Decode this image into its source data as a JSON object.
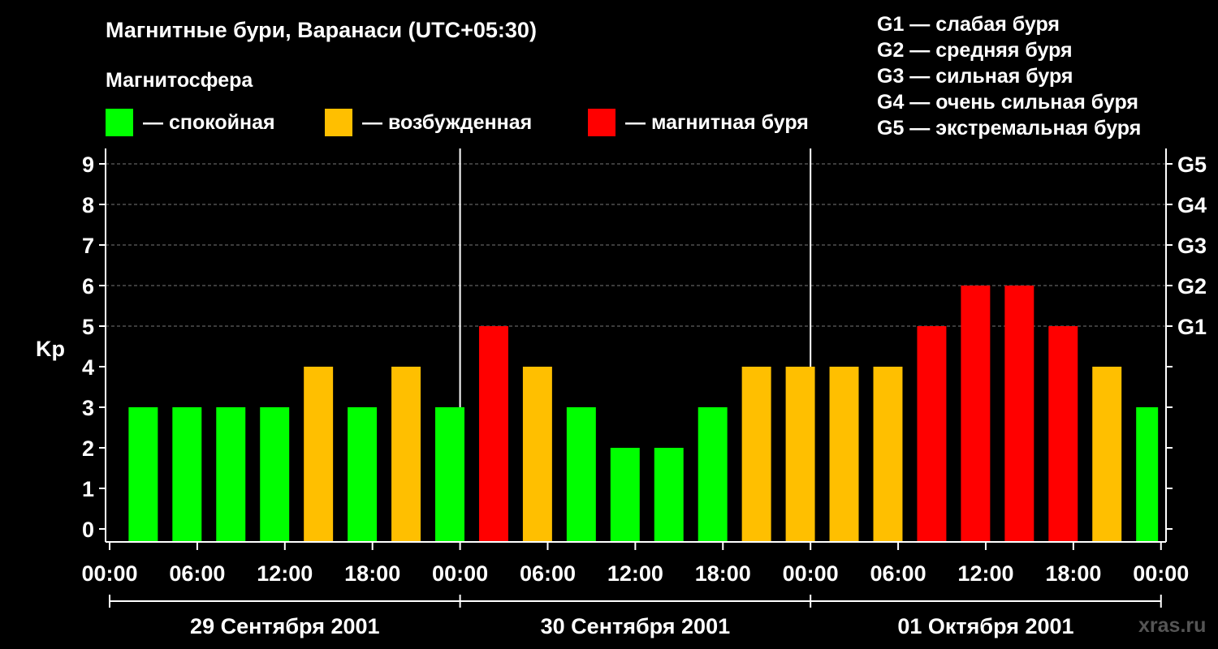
{
  "title": "Магнитные бури, Варанаси (UTC+05:30)",
  "magnetosphere_label": "Магнитосфера",
  "legend": [
    {
      "label": "— спокойная",
      "color": "#00ff00"
    },
    {
      "label": "— возбужденная",
      "color": "#ffbf00"
    },
    {
      "label": "— магнитная буря",
      "color": "#ff0000"
    }
  ],
  "g_scale_legend": [
    "G1 — слабая буря",
    "G2 — средняя буря",
    "G3 — сильная буря",
    "G4 — очень сильная буря",
    "G5 — экстремальная буря"
  ],
  "watermark": "xras.ru",
  "chart_data": {
    "type": "bar",
    "title": "Магнитные бури, Варанаси (UTC+05:30)",
    "ylabel": "Kp",
    "xlabel": "",
    "ylim": [
      0,
      9
    ],
    "yticks": [
      "0",
      "1",
      "2",
      "3",
      "4",
      "5",
      "6",
      "7",
      "8",
      "9"
    ],
    "right_axis_ticks": [
      {
        "value": 5,
        "label": "G1"
      },
      {
        "value": 6,
        "label": "G2"
      },
      {
        "value": 7,
        "label": "G3"
      },
      {
        "value": 8,
        "label": "G4"
      },
      {
        "value": 9,
        "label": "G5"
      }
    ],
    "x_tick_labels": [
      "00:00",
      "06:00",
      "12:00",
      "18:00",
      "00:00",
      "06:00",
      "12:00",
      "18:00",
      "00:00",
      "06:00",
      "12:00",
      "18:00",
      "00:00"
    ],
    "days": [
      "29 Сентября 2001",
      "30 Сентября 2001",
      "01 Октября 2001"
    ],
    "grid": true,
    "colors": {
      "quiet": "#00ff00",
      "active": "#ffbf00",
      "storm": "#ff0000"
    },
    "bars": [
      {
        "start": "29 Сентября 2001 01:30",
        "end": "29 Сентября 2001 03:30",
        "kp": 3,
        "level": "quiet"
      },
      {
        "start": "29 Сентября 2001 04:30",
        "end": "29 Сентября 2001 06:30",
        "kp": 3,
        "level": "quiet"
      },
      {
        "start": "29 Сентября 2001 07:30",
        "end": "29 Сентября 2001 09:30",
        "kp": 3,
        "level": "quiet"
      },
      {
        "start": "29 Сентября 2001 10:30",
        "end": "29 Сентября 2001 12:30",
        "kp": 3,
        "level": "quiet"
      },
      {
        "start": "29 Сентября 2001 13:30",
        "end": "29 Сентября 2001 15:30",
        "kp": 4,
        "level": "active"
      },
      {
        "start": "29 Сентября 2001 16:30",
        "end": "29 Сентября 2001 18:30",
        "kp": 3,
        "level": "quiet"
      },
      {
        "start": "29 Сентября 2001 19:30",
        "end": "29 Сентября 2001 21:30",
        "kp": 4,
        "level": "active"
      },
      {
        "start": "29 Сентября 2001 22:30",
        "end": "30 Сентября 2001 00:30",
        "kp": 3,
        "level": "quiet"
      },
      {
        "start": "30 Сентября 2001 01:30",
        "end": "30 Сентября 2001 03:30",
        "kp": 5,
        "level": "storm"
      },
      {
        "start": "30 Сентября 2001 04:30",
        "end": "30 Сентября 2001 06:30",
        "kp": 4,
        "level": "active"
      },
      {
        "start": "30 Сентября 2001 07:30",
        "end": "30 Сентября 2001 09:30",
        "kp": 3,
        "level": "quiet"
      },
      {
        "start": "30 Сентября 2001 10:30",
        "end": "30 Сентября 2001 12:30",
        "kp": 2,
        "level": "quiet"
      },
      {
        "start": "30 Сентября 2001 13:30",
        "end": "30 Сентября 2001 15:30",
        "kp": 2,
        "level": "quiet"
      },
      {
        "start": "30 Сентября 2001 16:30",
        "end": "30 Сентября 2001 18:30",
        "kp": 3,
        "level": "quiet"
      },
      {
        "start": "30 Сентября 2001 19:30",
        "end": "30 Сентября 2001 21:30",
        "kp": 4,
        "level": "active"
      },
      {
        "start": "30 Сентября 2001 22:30",
        "end": "01 Октября 2001 00:30",
        "kp": 4,
        "level": "active"
      },
      {
        "start": "01 Октября 2001 01:30",
        "end": "01 Октября 2001 03:30",
        "kp": 4,
        "level": "active"
      },
      {
        "start": "01 Октября 2001 04:30",
        "end": "01 Октября 2001 06:30",
        "kp": 4,
        "level": "active"
      },
      {
        "start": "01 Октября 2001 07:30",
        "end": "01 Октября 2001 09:30",
        "kp": 5,
        "level": "storm"
      },
      {
        "start": "01 Октября 2001 10:30",
        "end": "01 Октября 2001 12:30",
        "kp": 6,
        "level": "storm"
      },
      {
        "start": "01 Октября 2001 13:30",
        "end": "01 Октября 2001 15:30",
        "kp": 6,
        "level": "storm"
      },
      {
        "start": "01 Октября 2001 16:30",
        "end": "01 Октября 2001 18:30",
        "kp": 5,
        "level": "storm"
      },
      {
        "start": "01 Октября 2001 19:30",
        "end": "01 Октября 2001 21:30",
        "kp": 4,
        "level": "active"
      },
      {
        "start": "01 Октября 2001 22:30",
        "end": "02 Октября 2001 00:00",
        "kp": 3,
        "level": "quiet"
      }
    ]
  }
}
